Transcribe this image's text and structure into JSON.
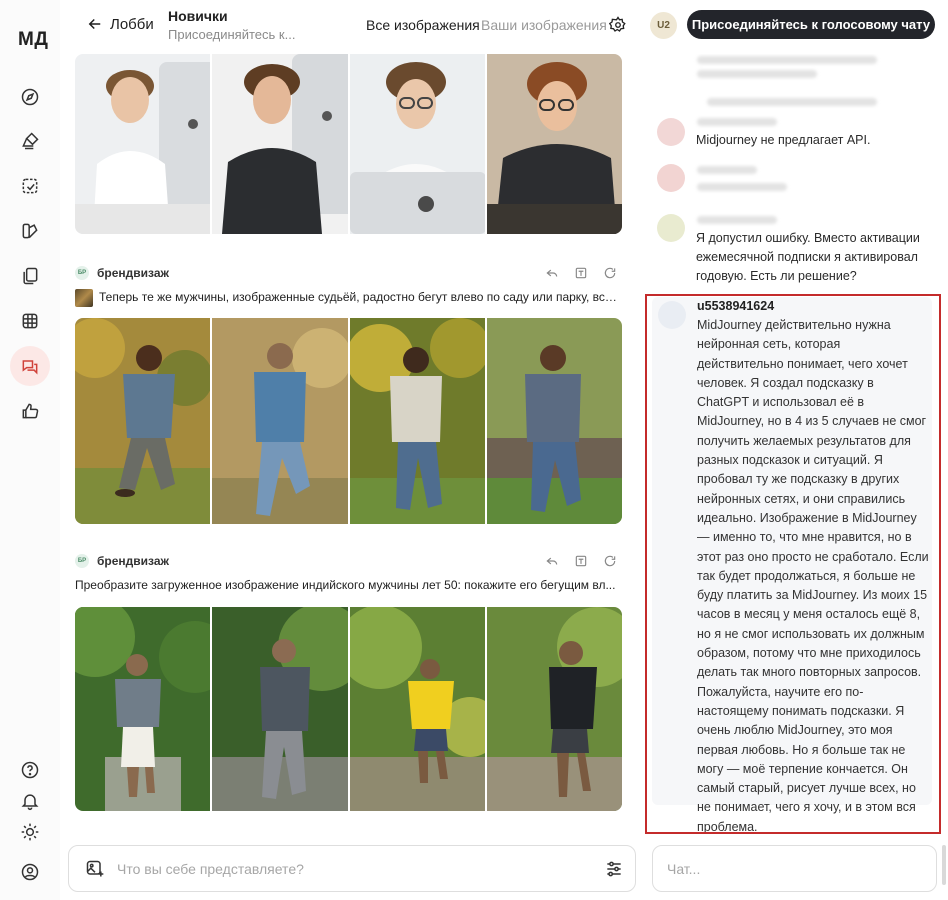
{
  "sidebar": {
    "logo": "МД",
    "top_icons": [
      "compass-icon",
      "brush-icon",
      "edit-icon",
      "palette-icon",
      "folders-icon",
      "grid-icon",
      "chat-icon",
      "thumbs-up-icon"
    ],
    "bottom_icons": [
      "help-icon",
      "bell-icon",
      "sun-icon",
      "account-icon"
    ],
    "active": "chat-icon",
    "active_color": "#fce8e6"
  },
  "header": {
    "back_label": "Лобби",
    "channel_title": "Новички",
    "channel_subtitle": "Присоединяйтесь к...",
    "tab_all": "Все изображения",
    "tab_yours": "Ваши изображения",
    "user_badge": "U2",
    "join_button": "Присоединяйтесь к голосовому чату"
  },
  "posts": [
    {
      "author": "брендвизаж",
      "badge": "БР",
      "prompt": "Теперь те же мужчины, изображенные судьёй, радостно бегут влево по саду или парку, всё т...",
      "scene": "garden"
    },
    {
      "author": "брендвизаж",
      "badge": "БР",
      "prompt": "Преобразите загруженное изображение индийского мужчины лет 50: покажите его бегущим вл...",
      "scene": "park"
    }
  ],
  "chat": {
    "messages": [
      {
        "text": "Midjourney не предлагает API."
      },
      {
        "text": "Я допустил ошибку. Вместо активации ежемесячной подписки я активировал годовую. Есть ли решение?"
      }
    ],
    "highlighted": {
      "username": "u5538941624",
      "text": "MidJourney действительно нужна нейронная сеть, которая действительно понимает, чего хочет человек. Я создал подсказку в ChatGPT и использовал её в MidJourney, но в 4 из 5 случаев не смог получить желаемых результатов для разных подсказок и ситуаций. Я пробовал ту же подсказку в других нейронных сетях, и они справились идеально. Изображение в MidJourney — именно то, что мне нравится, но в этот раз оно просто не сработало. Если так будет продолжаться, я больше не буду платить за MidJourney. Из моих 15 часов в месяц у меня осталось ещё 8, но я не смог использовать их должным образом, потому что мне приходилось делать так много повторных запросов. Пожалуйста, научите его по-настоящему понимать подсказки. Я очень люблю MidJourney, это моя первая любовь. Но я больше так не могу — моё терпение кончается. Он самый старый, рисует лучше всех, но не понимает, чего я хочу, и в этом вся проблема."
    },
    "highlight_color": "#c42b2b"
  },
  "inputs": {
    "prompt_placeholder": "Что вы себе представляете?",
    "chat_placeholder": "Чат..."
  }
}
